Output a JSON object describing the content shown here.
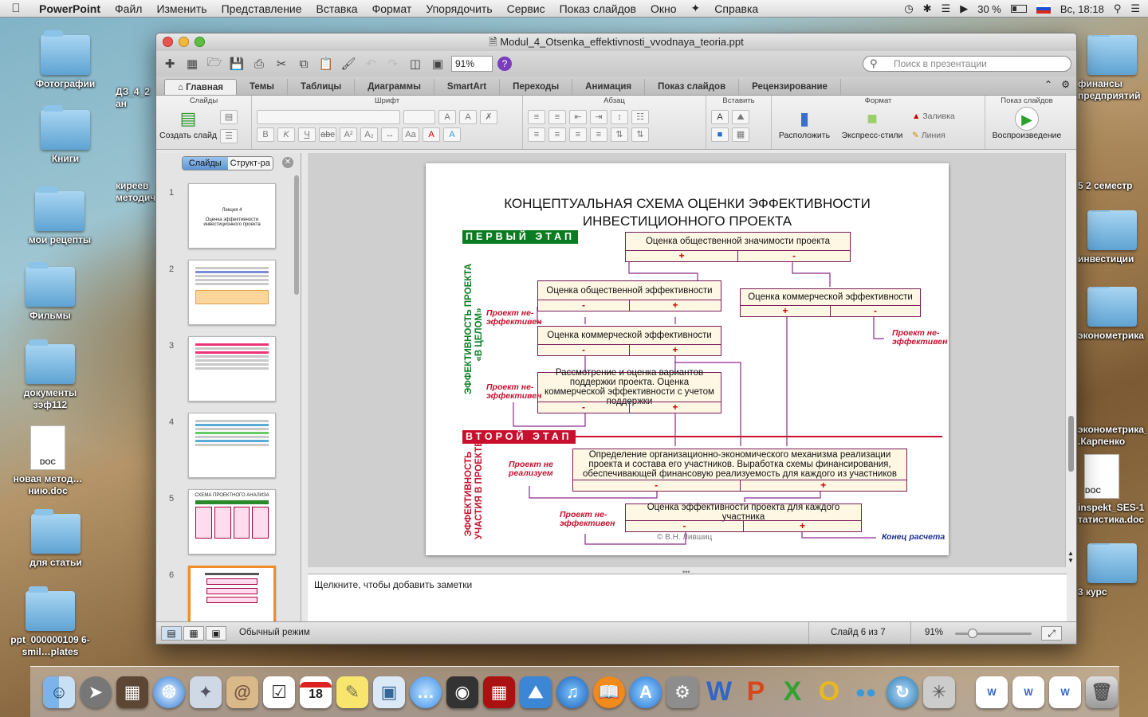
{
  "menubar": {
    "apple": "",
    "app": "PowerPoint",
    "items": [
      "Файл",
      "Изменить",
      "Представление",
      "Вставка",
      "Формат",
      "Упорядочить",
      "Сервис",
      "Показ слайдов",
      "Окно",
      "Справка"
    ],
    "battery": "30 %",
    "clock": "Вс, 18:18"
  },
  "desktop": {
    "left": [
      {
        "label": "Фотографии"
      },
      {
        "label": "Книги"
      },
      {
        "label": "мои рецепты"
      },
      {
        "label": "Фильмы"
      },
      {
        "label": "документы зэф112"
      },
      {
        "label": "новая метод…нию.doc",
        "doc": "DOC"
      },
      {
        "label": "для статьи"
      },
      {
        "label": "ppt_000000109 6-smil…plates"
      }
    ],
    "col2": [
      {
        "label": "ДЗ_4_2 ан"
      },
      {
        "label": "киреев методич"
      }
    ],
    "right": [
      {
        "label": "финансы предприятий"
      },
      {
        "label": "5 2 семестр"
      },
      {
        "label": "инвестиции"
      },
      {
        "label": "эконометрика"
      },
      {
        "label": "эконометрика_ .Карпенко"
      },
      {
        "label": "inspekt_SES-1 татистика.doc",
        "doc": "DOC"
      },
      {
        "label": "3 курс"
      }
    ]
  },
  "window": {
    "title": "Modul_4_Otsenka_effektivnosti_vvodnaya_teoria.ppt",
    "zoom": "91%",
    "search_placeholder": "Поиск в презентации",
    "tabs": [
      "Главная",
      "Темы",
      "Таблицы",
      "Диаграммы",
      "SmartArt",
      "Переходы",
      "Анимация",
      "Показ слайдов",
      "Рецензирование"
    ],
    "ribbon": {
      "slides": {
        "header": "Слайды",
        "new_slide": "Создать слайд"
      },
      "font": {
        "header": "Шрифт"
      },
      "paragraph": {
        "header": "Абзац"
      },
      "insert": {
        "header": "Вставить"
      },
      "format": {
        "header": "Формат",
        "arrange": "Расположить",
        "quick_styles": "Экспресс-стили",
        "fill": "Заливка",
        "line": "Линия"
      },
      "slideshow": {
        "header": "Показ слайдов",
        "play": "Воспроизведение"
      }
    },
    "panel": {
      "tab_slides": "Слайды",
      "tab_outline": "Структ-ра"
    },
    "thumbnails": [
      {
        "num": "1",
        "title": "Лекция 4",
        "sub": "Оценка эффективности инвестиционного проекта"
      },
      {
        "num": "2"
      },
      {
        "num": "3"
      },
      {
        "num": "4"
      },
      {
        "num": "5",
        "title": "СХЕМА ПРОЕКТНОГО АНАЛИЗА"
      },
      {
        "num": "6"
      }
    ],
    "notes_placeholder": "Щелкните, чтобы добавить заметки",
    "status": {
      "mode": "Обычный режим",
      "slide": "Слайд 6 из 7",
      "zoom": "91%"
    }
  },
  "slide": {
    "title1": "КОНЦЕПТУАЛЬНАЯ СХЕМА ОЦЕНКИ ЭФФЕКТИВНОСТИ",
    "title2": "ИНВЕСТИЦИОННОГО ПРОЕКТА",
    "stage1": "ПЕРВЫЙ ЭТАП",
    "stage2": "ВТОРОЙ ЭТАП",
    "side1": "ЭФФЕКТИВНОСТЬ ПРОЕКТА «В ЦЕЛОМ»",
    "side1a": "ЭФФЕКТИВНОСТЬ ПРОЕКТА",
    "side1b": "«В ЦЕЛОМ»",
    "side2a": "ЭФФЕКТИВНОСТЬ",
    "side2b": "УЧАСТИЯ В ПРОЕКТЕ",
    "box_public_significance": "Оценка общественной значимости проекта",
    "box_public_eff": "Оценка общественной эффективности",
    "box_commercial_eff_right": "Оценка коммерческой эффективности",
    "box_commercial_eff": "Оценка коммерческой эффективности",
    "box_support": "Рассмотрение и оценка вариантов поддержки проекта. Оценка коммерческой эффективности с учетом поддержки",
    "box_mechanism": "Определение организационно-экономического механизма реализации проекта и состава его участников. Выработка схемы финансирования, обеспечивающей финансовую реализуемость для каждого из участников",
    "box_participant": "Оценка эффективности проекта для каждого участника",
    "plus": "+",
    "minus": "-",
    "note_ineff": "Проект не-эффективен",
    "note_not_realized": "Проект не реализуем",
    "note_end": "Конец расчета",
    "copyright": "© В.Н. Лившиц",
    "colors": {
      "stage1": "#0a7d22",
      "stage2": "#c8102e",
      "box_border": "#7b1a5d",
      "line": "#8a2a8a"
    }
  },
  "dock": [
    "finder",
    "launchpad",
    "photo-booth",
    "safari",
    "mail-bird",
    "contacts",
    "reminders",
    "calendar",
    "notes",
    "preview",
    "messages",
    "facetime",
    "photo-booth-2",
    "iphoto",
    "itunes",
    "ibooks",
    "app-store",
    "system-preferences",
    "word",
    "powerpoint",
    "excel",
    "outlook",
    "messenger",
    "sync",
    "network",
    "doc1",
    "doc2",
    "doc3",
    "trash"
  ],
  "dock_calendar_day": "18"
}
